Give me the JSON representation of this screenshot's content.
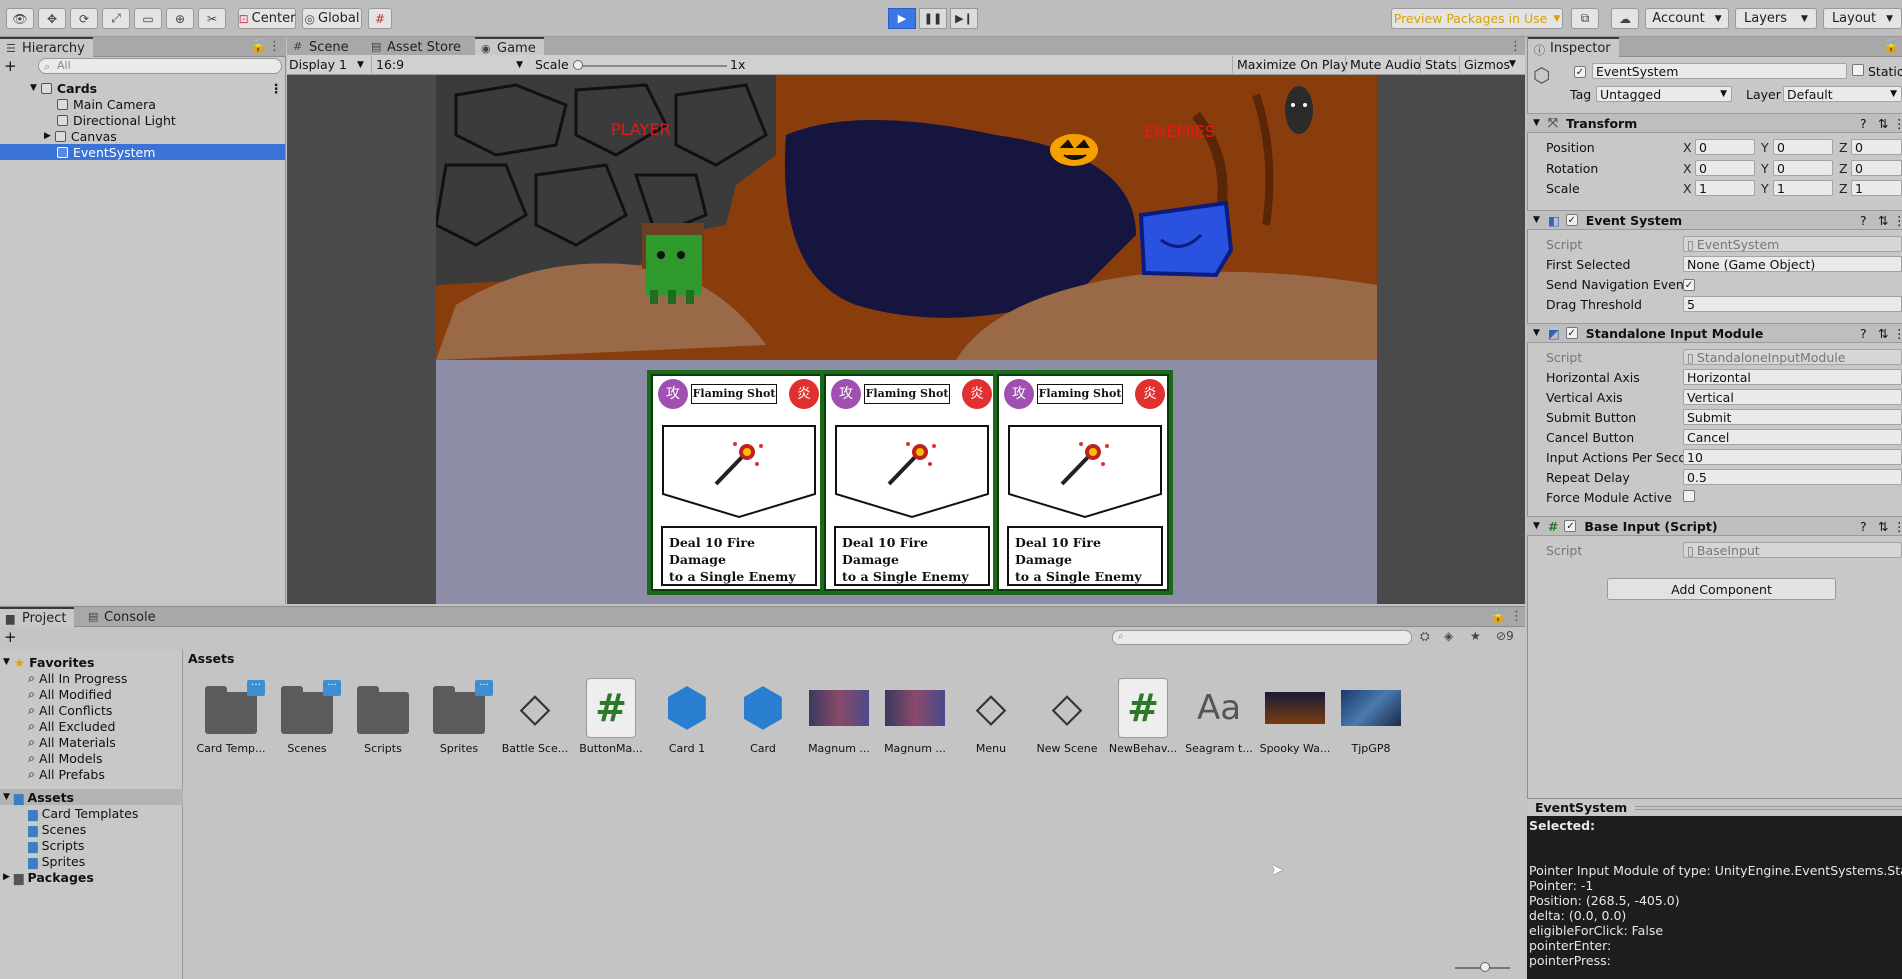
{
  "toolbar": {
    "center_label": "Center",
    "global_label": "Global",
    "preview_packages_label": "Preview Packages in Use",
    "account_label": "Account",
    "layers_label": "Layers",
    "layout_label": "Layout"
  },
  "hierarchy": {
    "tab_label": "Hierarchy",
    "search_placeholder": "All",
    "scene_name": "Cards",
    "items": [
      "Main Camera",
      "Directional Light",
      "Canvas",
      "EventSystem"
    ]
  },
  "view_tabs": [
    "Scene",
    "Asset Store",
    "Game"
  ],
  "game_bar": {
    "display": "Display 1",
    "aspect": "16:9",
    "scale_label": "Scale",
    "scale_value": "1x",
    "maximize": "Maximize On Play",
    "mute": "Mute Audio",
    "stats": "Stats",
    "gizmos": "Gizmos"
  },
  "game": {
    "player_label": "PLAYER",
    "enemies_label": "ENEMIES",
    "cards": [
      {
        "title": "Flaming Shot",
        "description_line1": "Deal 10 Fire Damage",
        "description_line2": "to a Single Enemy"
      },
      {
        "title": "Flaming Shot",
        "description_line1": "Deal 10 Fire Damage",
        "description_line2": "to a Single Enemy"
      },
      {
        "title": "Flaming Shot",
        "description_line1": "Deal 10 Fire Damage",
        "description_line2": "to a Single Enemy"
      }
    ]
  },
  "inspector": {
    "tab_label": "Inspector",
    "object_name": "EventSystem",
    "static_label": "Static",
    "tag_label": "Tag",
    "tag_value": "Untagged",
    "layer_label": "Layer",
    "layer_value": "Default",
    "transform": {
      "title": "Transform",
      "position_label": "Position",
      "rotation_label": "Rotation",
      "scale_label": "Scale",
      "position": [
        "0",
        "0",
        "0"
      ],
      "rotation": [
        "0",
        "0",
        "0"
      ],
      "scale": [
        "1",
        "1",
        "1"
      ]
    },
    "event_system": {
      "title": "Event System",
      "script_label": "Script",
      "script_value": "EventSystem",
      "first_selected_label": "First Selected",
      "first_selected_value": "None (Game Object)",
      "send_nav_label": "Send Navigation Events",
      "drag_label": "Drag Threshold",
      "drag_value": "5"
    },
    "standalone": {
      "title": "Standalone Input Module",
      "script_label": "Script",
      "script_value": "StandaloneInputModule",
      "rows": [
        {
          "label": "Horizontal Axis",
          "value": "Horizontal"
        },
        {
          "label": "Vertical Axis",
          "value": "Vertical"
        },
        {
          "label": "Submit Button",
          "value": "Submit"
        },
        {
          "label": "Cancel Button",
          "value": "Cancel"
        },
        {
          "label": "Input Actions Per Secon",
          "value": "10"
        },
        {
          "label": "Repeat Delay",
          "value": "0.5"
        }
      ],
      "force_label": "Force Module Active"
    },
    "base_input": {
      "title": "Base Input (Script)",
      "script_label": "Script",
      "script_value": "BaseInput"
    },
    "add_component": "Add Component"
  },
  "preview": {
    "title": "EventSystem",
    "lines": [
      "Selected:",
      "",
      "Pointer Input Module of type: UnityEngine.EventSystems.Standalo",
      "Pointer: -1",
      "Position: (268.5, -405.0)",
      "delta: (0.0, 0.0)",
      "eligibleForClick: False",
      "pointerEnter:",
      "pointerPress:"
    ]
  },
  "project": {
    "tabs": [
      "Project",
      "Console"
    ],
    "favorites_label": "Favorites",
    "favorites": [
      "All In Progress",
      "All Modified",
      "All Conflicts",
      "All Excluded",
      "All Materials",
      "All Models",
      "All Prefabs"
    ],
    "assets_label": "Assets",
    "asset_folders": [
      "Card Templates",
      "Scenes",
      "Scripts",
      "Sprites"
    ],
    "packages_label": "Packages",
    "breadcrumb": "Assets",
    "hidden_count": "9",
    "assets": [
      {
        "name": "Card Temp...",
        "kind": "folder-badge"
      },
      {
        "name": "Scenes",
        "kind": "folder-badge"
      },
      {
        "name": "Scripts",
        "kind": "folder"
      },
      {
        "name": "Sprites",
        "kind": "folder-badge"
      },
      {
        "name": "Battle Sce...",
        "kind": "unity"
      },
      {
        "name": "ButtonMa...",
        "kind": "script"
      },
      {
        "name": "Card 1",
        "kind": "prefab"
      },
      {
        "name": "Card",
        "kind": "prefab"
      },
      {
        "name": "Magnum ...",
        "kind": "image"
      },
      {
        "name": "Magnum ...",
        "kind": "image"
      },
      {
        "name": "Menu",
        "kind": "unity"
      },
      {
        "name": "New Scene",
        "kind": "unity"
      },
      {
        "name": "NewBehav...",
        "kind": "script"
      },
      {
        "name": "Seagram t...",
        "kind": "font"
      },
      {
        "name": "Spooky Wa...",
        "kind": "image-dark"
      },
      {
        "name": "TjpGP8",
        "kind": "image-blue"
      }
    ]
  }
}
